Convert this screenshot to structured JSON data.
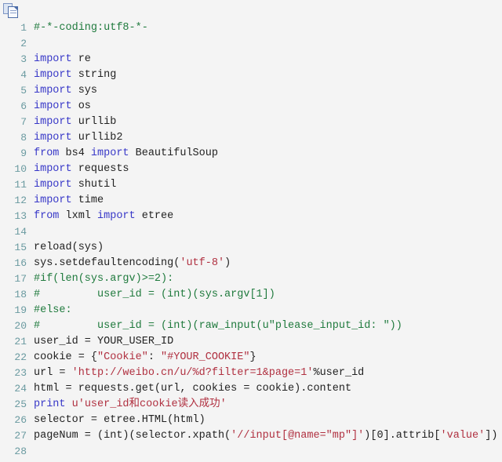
{
  "window": {
    "title": "Python code snippet",
    "background_color": "#f4f4f4"
  },
  "toolbar": {
    "copy_icon_name": "copy-icon",
    "copy_tooltip": "copy"
  },
  "syntax_colors": {
    "comment": "#1f7a3d",
    "keyword": "#3838c8",
    "string": "#b03040",
    "plain": "#222222",
    "line_number": "#6a9aa0",
    "background": "#f4f4f4"
  },
  "code": {
    "language": "python",
    "first_line_number": 1,
    "last_visible_line_number": 28,
    "lines": [
      {
        "n": "1",
        "tokens": [
          {
            "t": "#-*-coding:utf8-*-",
            "c": "com"
          }
        ]
      },
      {
        "n": "2",
        "tokens": [
          {
            "t": "",
            "c": "pln"
          }
        ]
      },
      {
        "n": "3",
        "tokens": [
          {
            "t": "import",
            "c": "kw"
          },
          {
            "t": " re",
            "c": "pln"
          }
        ]
      },
      {
        "n": "4",
        "tokens": [
          {
            "t": "import",
            "c": "kw"
          },
          {
            "t": " string",
            "c": "pln"
          }
        ]
      },
      {
        "n": "5",
        "tokens": [
          {
            "t": "import",
            "c": "kw"
          },
          {
            "t": " sys",
            "c": "pln"
          }
        ]
      },
      {
        "n": "6",
        "tokens": [
          {
            "t": "import",
            "c": "kw"
          },
          {
            "t": " os",
            "c": "pln"
          }
        ]
      },
      {
        "n": "7",
        "tokens": [
          {
            "t": "import",
            "c": "kw"
          },
          {
            "t": " urllib",
            "c": "pln"
          }
        ]
      },
      {
        "n": "8",
        "tokens": [
          {
            "t": "import",
            "c": "kw"
          },
          {
            "t": " urllib2",
            "c": "pln"
          }
        ]
      },
      {
        "n": "9",
        "tokens": [
          {
            "t": "from",
            "c": "kw"
          },
          {
            "t": " bs4 ",
            "c": "pln"
          },
          {
            "t": "import",
            "c": "kw"
          },
          {
            "t": " BeautifulSoup",
            "c": "pln"
          }
        ]
      },
      {
        "n": "10",
        "tokens": [
          {
            "t": "import",
            "c": "kw"
          },
          {
            "t": " requests",
            "c": "pln"
          }
        ]
      },
      {
        "n": "11",
        "tokens": [
          {
            "t": "import",
            "c": "kw"
          },
          {
            "t": " shutil",
            "c": "pln"
          }
        ]
      },
      {
        "n": "12",
        "tokens": [
          {
            "t": "import",
            "c": "kw"
          },
          {
            "t": " time",
            "c": "pln"
          }
        ]
      },
      {
        "n": "13",
        "tokens": [
          {
            "t": "from",
            "c": "kw"
          },
          {
            "t": " lxml ",
            "c": "pln"
          },
          {
            "t": "import",
            "c": "kw"
          },
          {
            "t": " etree",
            "c": "pln"
          }
        ]
      },
      {
        "n": "14",
        "tokens": [
          {
            "t": "",
            "c": "pln"
          }
        ]
      },
      {
        "n": "15",
        "tokens": [
          {
            "t": "reload(sys)",
            "c": "pln"
          }
        ]
      },
      {
        "n": "16",
        "tokens": [
          {
            "t": "sys.setdefaultencoding(",
            "c": "pln"
          },
          {
            "t": "'utf-8'",
            "c": "str"
          },
          {
            "t": ")",
            "c": "pln"
          }
        ]
      },
      {
        "n": "17",
        "tokens": [
          {
            "t": "#if(len(sys.argv)>=2):",
            "c": "com"
          }
        ]
      },
      {
        "n": "18",
        "tokens": [
          {
            "t": "#         user_id = (int)(sys.argv[1])",
            "c": "com"
          }
        ]
      },
      {
        "n": "19",
        "tokens": [
          {
            "t": "#else:",
            "c": "com"
          }
        ]
      },
      {
        "n": "20",
        "tokens": [
          {
            "t": "#         user_id = (int)(raw_input(u\"please_input_id: \"))",
            "c": "com"
          }
        ]
      },
      {
        "n": "21",
        "tokens": [
          {
            "t": "user_id = YOUR_USER_ID",
            "c": "pln"
          }
        ]
      },
      {
        "n": "22",
        "tokens": [
          {
            "t": "cookie = {",
            "c": "pln"
          },
          {
            "t": "\"Cookie\"",
            "c": "str"
          },
          {
            "t": ": ",
            "c": "pln"
          },
          {
            "t": "\"#YOUR_COOKIE\"",
            "c": "str"
          },
          {
            "t": "}",
            "c": "pln"
          }
        ]
      },
      {
        "n": "23",
        "tokens": [
          {
            "t": "url = ",
            "c": "pln"
          },
          {
            "t": "'http://weibo.cn/u/%d?filter=1&page=1'",
            "c": "str"
          },
          {
            "t": "%user_id",
            "c": "pln"
          }
        ]
      },
      {
        "n": "24",
        "tokens": [
          {
            "t": "html = requests.get(url, cookies = cookie).content",
            "c": "pln"
          }
        ]
      },
      {
        "n": "25",
        "tokens": [
          {
            "t": "print",
            "c": "kw"
          },
          {
            "t": " ",
            "c": "pln"
          },
          {
            "t": "u'user_id和cookie读入成功'",
            "c": "str"
          }
        ]
      },
      {
        "n": "26",
        "tokens": [
          {
            "t": "selector = etree.HTML(html)",
            "c": "pln"
          }
        ]
      },
      {
        "n": "27",
        "tokens": [
          {
            "t": "pageNum = (int)(selector.xpath(",
            "c": "pln"
          },
          {
            "t": "'//input[@name=\"mp\"]'",
            "c": "str"
          },
          {
            "t": ")[0].attrib[",
            "c": "pln"
          },
          {
            "t": "'value'",
            "c": "str"
          },
          {
            "t": "])",
            "c": "pln"
          }
        ]
      },
      {
        "n": "28",
        "tokens": [
          {
            "t": "",
            "c": "pln"
          }
        ]
      }
    ]
  }
}
